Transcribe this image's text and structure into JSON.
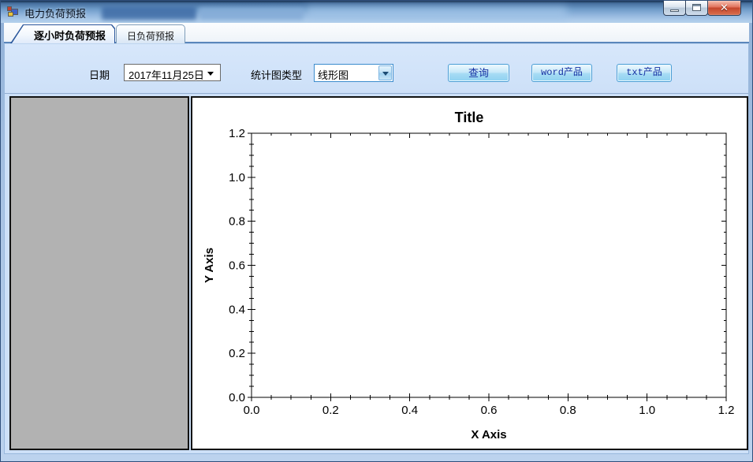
{
  "window": {
    "title": "电力负荷预报"
  },
  "window_controls": {
    "minimize": "minimize",
    "maximize": "maximize",
    "close": "close"
  },
  "tabs": [
    {
      "label": "逐小时负荷预报",
      "selected": true
    },
    {
      "label": "日负荷预报",
      "selected": false
    }
  ],
  "toolbar": {
    "date_label": "日期",
    "date_value": "2017年11月25日",
    "chart_type_label": "统计图类型",
    "chart_type_value": "线形图",
    "buttons": {
      "query": "查询",
      "word": "word产品",
      "txt": "txt产品"
    }
  },
  "left_panel": {
    "content": ""
  },
  "chart_data": {
    "type": "line",
    "title": "Title",
    "xlabel": "X Axis",
    "ylabel": "Y Axis",
    "xlim": [
      0.0,
      1.2
    ],
    "ylim": [
      0.0,
      1.2
    ],
    "x_major_ticks": [
      0.0,
      0.2,
      0.4,
      0.6,
      0.8,
      1.0,
      1.2
    ],
    "y_major_ticks": [
      0.0,
      0.2,
      0.4,
      0.6,
      0.8,
      1.0,
      1.2
    ],
    "minor_tick_step": 0.05,
    "grid": false,
    "legend": "none",
    "series": []
  },
  "colors": {
    "titlebar_blue": "#6f9cc9",
    "tab_page_bg": "#cde0f8",
    "panel_gray": "#b2b2b2",
    "button_face": "#a6dbf4",
    "button_border": "#4d9fd6",
    "button_text": "#1630a2",
    "combo_border": "#3c8ccd",
    "close_button_red": "#c4452c",
    "chart_axis": "#000000"
  }
}
